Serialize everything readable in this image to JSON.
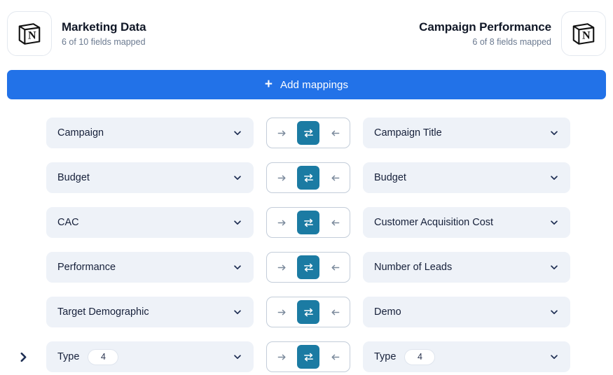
{
  "header": {
    "left": {
      "icon": "notion-logo-icon",
      "title": "Marketing Data",
      "subtitle": "6 of 10 fields mapped"
    },
    "right": {
      "icon": "notion-logo-icon",
      "title": "Campaign Performance",
      "subtitle": "6 of 8 fields mapped"
    }
  },
  "add_mappings": {
    "icon": "plus-icon",
    "label": "Add mappings",
    "plus": "+",
    "color": "#2272e8"
  },
  "direction_toggle": {
    "forward_icon": "arrow-right-icon",
    "both_icon": "swap-horizontal-icon",
    "backward_icon": "arrow-left-icon",
    "active": "both",
    "active_color": "#1b7ba3"
  },
  "mappings": [
    {
      "source": {
        "name": "Campaign",
        "count": null
      },
      "target": {
        "name": "Campaign Title",
        "count": null
      },
      "direction": "both",
      "expandable": false
    },
    {
      "source": {
        "name": "Budget",
        "count": null
      },
      "target": {
        "name": "Budget",
        "count": null
      },
      "direction": "both",
      "expandable": false
    },
    {
      "source": {
        "name": "CAC",
        "count": null
      },
      "target": {
        "name": "Customer Acquisition Cost",
        "count": null
      },
      "direction": "both",
      "expandable": false
    },
    {
      "source": {
        "name": "Performance",
        "count": null
      },
      "target": {
        "name": "Number of Leads",
        "count": null
      },
      "direction": "both",
      "expandable": false
    },
    {
      "source": {
        "name": "Target Demographic",
        "count": null
      },
      "target": {
        "name": "Demo",
        "count": null
      },
      "direction": "both",
      "expandable": false
    },
    {
      "source": {
        "name": "Type",
        "count": "4"
      },
      "target": {
        "name": "Type",
        "count": "4"
      },
      "direction": "both",
      "expandable": true
    }
  ]
}
